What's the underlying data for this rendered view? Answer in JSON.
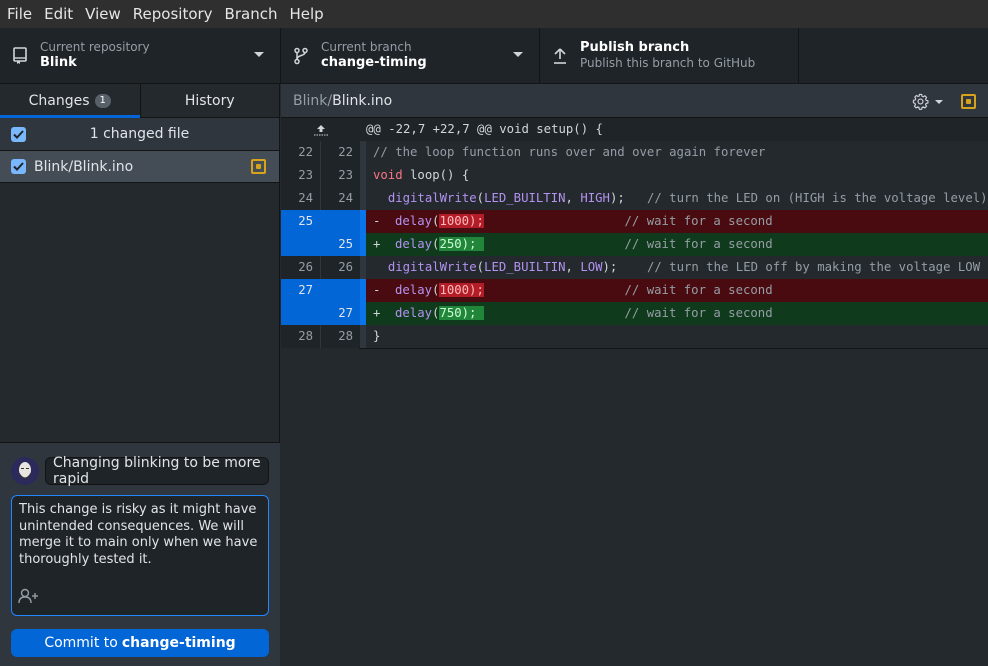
{
  "menu": [
    "File",
    "Edit",
    "View",
    "Repository",
    "Branch",
    "Help"
  ],
  "toolbar": {
    "repo_label": "Current repository",
    "repo_value": "Blink",
    "branch_label": "Current branch",
    "branch_value": "change-timing",
    "publish_label": "Publish branch",
    "publish_sub": "Publish this branch to GitHub"
  },
  "sidebar": {
    "tabs": [
      {
        "label": "Changes",
        "badge": "1"
      },
      {
        "label": "History"
      }
    ],
    "changes_header": "1 changed file",
    "files": [
      {
        "path": "Blink/Blink.ino",
        "status": "modified"
      }
    ]
  },
  "commit": {
    "summary": "Changing blinking to be more rapid",
    "description": "This change is risky as it might have unintended consequences. We will merge it to main only when we have thoroughly tested it.",
    "button_prefix": "Commit to",
    "button_branch": "change-timing"
  },
  "diff": {
    "path_dir": "Blink/",
    "path_file": "Blink.ino",
    "hunk": "@@ -22,7 +22,7 @@ void setup() {",
    "rows": [
      {
        "type": "ctx",
        "old": "22",
        "new": "22"
      },
      {
        "type": "ctx",
        "old": "23",
        "new": "23"
      },
      {
        "type": "ctx",
        "old": "24",
        "new": "24"
      },
      {
        "type": "del",
        "old": "25",
        "new": ""
      },
      {
        "type": "add",
        "old": "",
        "new": "25"
      },
      {
        "type": "ctx",
        "old": "26",
        "new": "26"
      },
      {
        "type": "del",
        "old": "27",
        "new": ""
      },
      {
        "type": "add",
        "old": "",
        "new": "27"
      },
      {
        "type": "ctx",
        "old": "28",
        "new": "28"
      }
    ],
    "code": {
      "l22_comment": "// the loop function runs over and over again forever",
      "l23_kw": "void",
      "l23_rest": " loop() {",
      "fn_digitalWrite": "digitalWrite",
      "const_led": "LED_BUILTIN",
      "const_high": "HIGH",
      "const_low": "LOW",
      "fn_delay": "delay",
      "l24_comment": "// turn the LED on (HIGH is the voltage level)",
      "l26_comment": "// turn the LED off by making the voltage LOW",
      "wait_comment": "// wait for a second",
      "old_val_1": "1000);",
      "new_val_1": "250); ",
      "old_val_2": "1000);",
      "new_val_2": "750); ",
      "close_brace": "}",
      "minus": "-",
      "plus": "+"
    }
  },
  "colors": {
    "accent": "#0366d6",
    "modified": "#d7a31a",
    "deleted_bg": "#490b10",
    "added_bg": "#0f3b1c"
  }
}
